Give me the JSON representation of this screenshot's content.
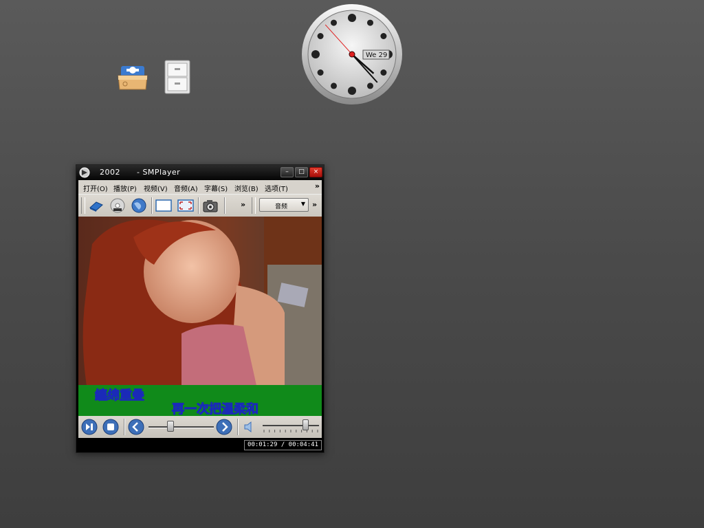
{
  "clock": {
    "date_label": "We 29",
    "hour": 4,
    "minute": 23,
    "second": 53
  },
  "window": {
    "title": "2002      - SMPlayer",
    "buttons": {
      "minimize": "–",
      "maximize": "□",
      "close": "×"
    }
  },
  "menubar": {
    "items": [
      {
        "label": "打开(O)",
        "icon": ""
      },
      {
        "label": "播放(P)"
      },
      {
        "label": "视频(V)"
      },
      {
        "label": "音频(A)"
      },
      {
        "label": "字幕(S)"
      },
      {
        "label": "浏览(B)"
      },
      {
        "label": "选项(T)"
      }
    ],
    "more": "»"
  },
  "toolbar": {
    "icons": [
      "open-file-icon",
      "open-dvd-icon",
      "open-url-icon",
      "compact-view-icon",
      "fullscreen-icon",
      "screenshot-icon"
    ],
    "more": "»",
    "audio_select": "音频",
    "more2": "»"
  },
  "video": {
    "subtitle_line1": "纏绵重叠",
    "subtitle_line2": "再一次把温柔和"
  },
  "controls": {
    "seek_position": 0.34,
    "volume_level": 0.76
  },
  "status": {
    "time": "00:01:29 / 00:04:41"
  },
  "colors": {
    "accent": "#3d6fb8",
    "close_red": "#d4271c",
    "subtitle_band": "#108a1a"
  }
}
